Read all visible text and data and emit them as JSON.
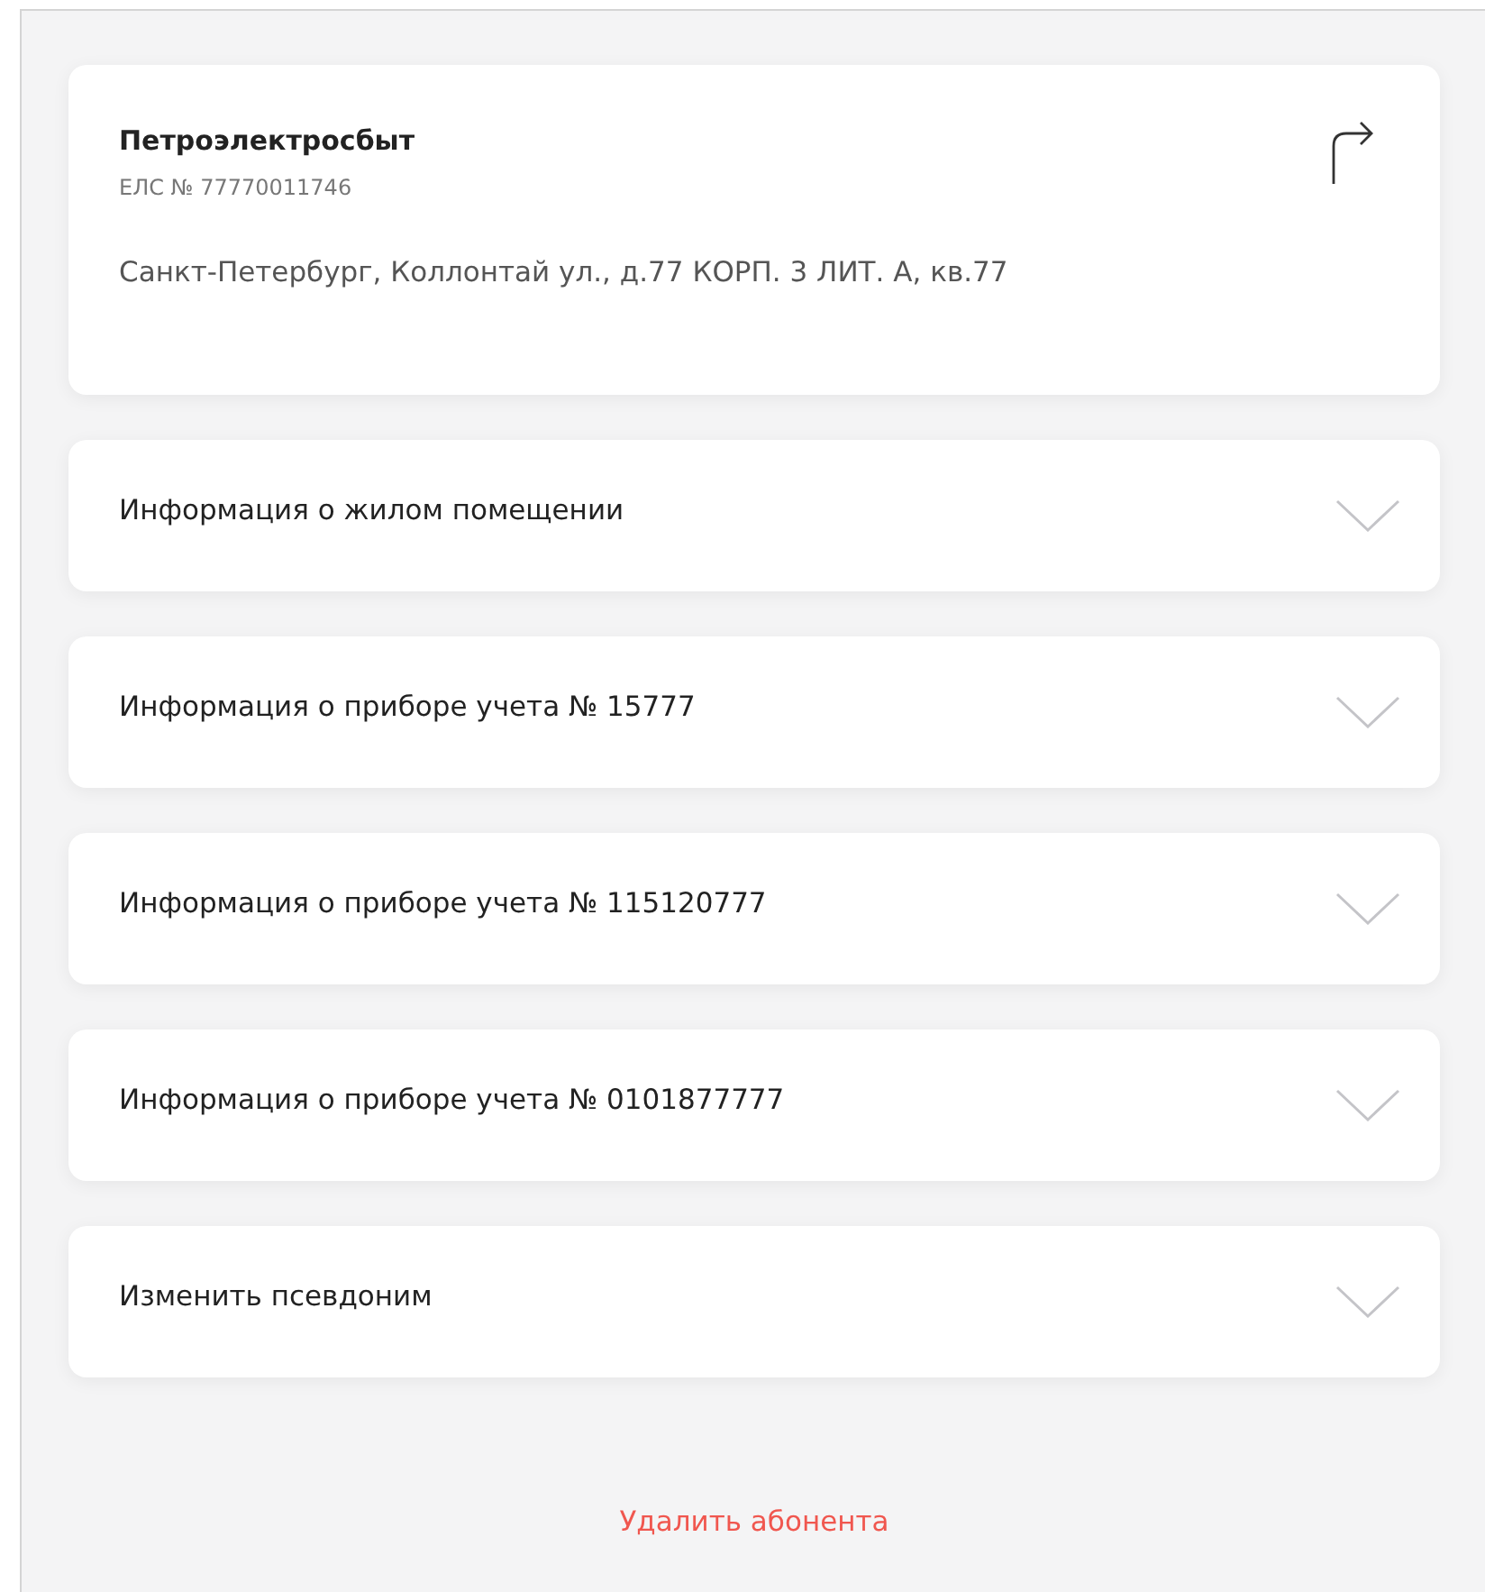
{
  "account": {
    "provider": "Петроэлектросбыт",
    "els": "ЕЛС № 77770011746",
    "address": "Санкт-Петербург, Коллонтай ул., д.77 КОРП. 3 ЛИТ. А, кв.77"
  },
  "sections": [
    {
      "title": "Информация о жилом помещении",
      "expanded": false
    },
    {
      "title": "Информация о приборе учета № 15777",
      "expanded": false
    },
    {
      "title": "Информация о приборе учета № 115120777",
      "expanded": false
    },
    {
      "title": "Информация о приборе учета № 0101877777",
      "expanded": false
    },
    {
      "title": "Изменить псевдоним",
      "expanded": false
    }
  ],
  "delete_link": "Удалить абонента"
}
